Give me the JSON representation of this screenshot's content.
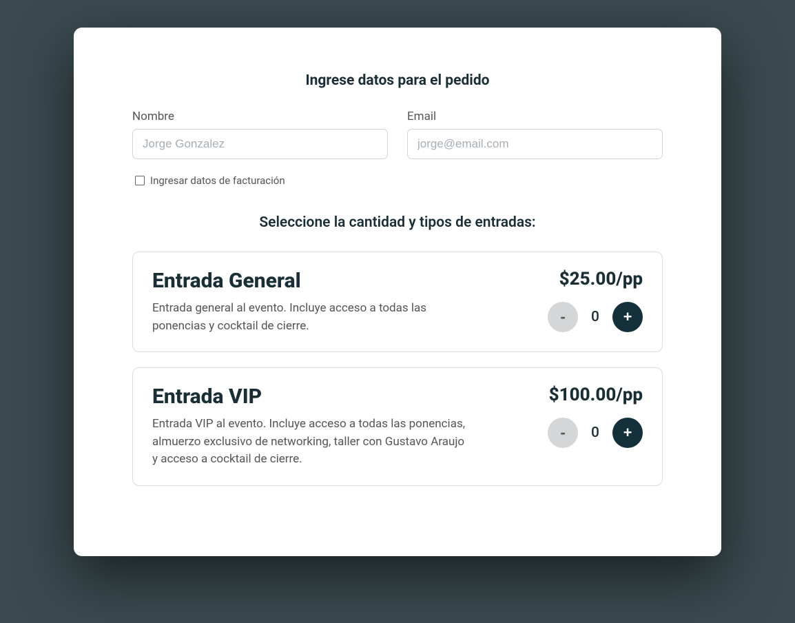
{
  "heading": "Ingrese datos para el pedido",
  "form": {
    "name_label": "Nombre",
    "name_placeholder": "Jorge Gonzalez",
    "email_label": "Email",
    "email_placeholder": "jorge@email.com",
    "billing_checkbox_label": "Ingresar datos de facturación"
  },
  "subheading": "Seleccione la cantidad y tipos de entradas:",
  "tickets": [
    {
      "title": "Entrada General",
      "description": "Entrada general al evento. Incluye acceso a todas las ponencias y cocktail de cierre.",
      "price": "$25.00/pp",
      "quantity": "0"
    },
    {
      "title": "Entrada VIP",
      "description": "Entrada VIP al evento. Incluye acceso a todas las ponencias, almuerzo exclusivo de networking, taller con Gustavo Araujo y acceso a cocktail de cierre.",
      "price": "$100.00/pp",
      "quantity": "0"
    }
  ],
  "buttons": {
    "minus": "-",
    "plus": "+"
  }
}
